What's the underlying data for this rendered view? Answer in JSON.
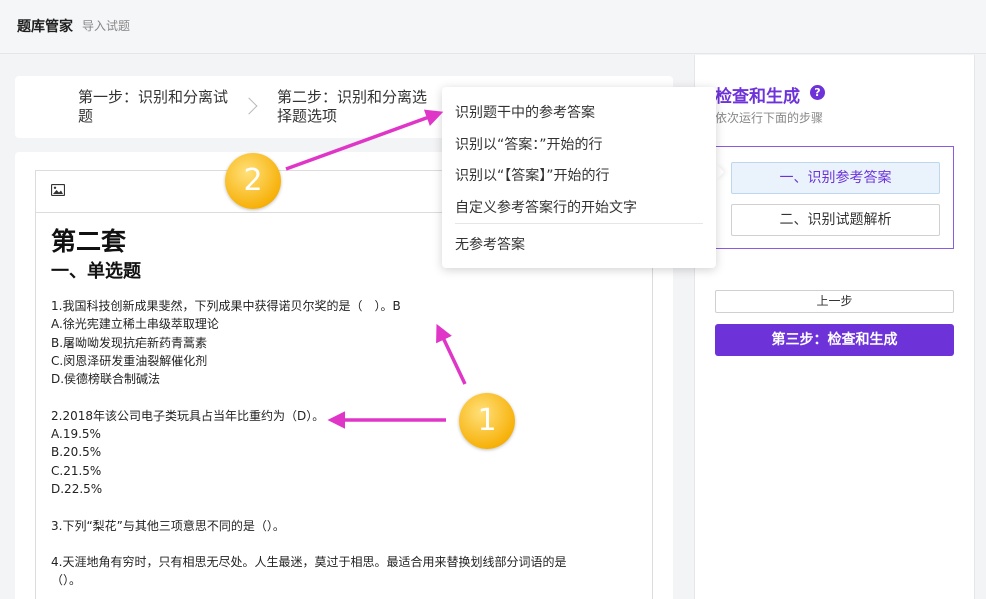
{
  "header": {
    "title": "题库管家",
    "subtitle": "导入试题"
  },
  "steps": [
    {
      "label": "第一步：识别和分离试题"
    },
    {
      "label": "第二步：识别和分离选择题选项"
    }
  ],
  "editor": {
    "heading1": "第二套",
    "heading2": "一、单选题",
    "lines": [
      "1.我国科技创新成果斐然，下列成果中获得诺贝尔奖的是（　）。B",
      "A.徐光宪建立稀土串级萃取理论",
      "B.屠呦呦发现抗疟新药青蒿素",
      "C.闵恩泽研发重油裂解催化剂",
      "D.侯德榜联合制碱法",
      "",
      "2.2018年该公司电子类玩具占当年比重约为（D）。",
      "A.19.5%",
      "B.20.5%",
      "C.21.5%",
      "D.22.5%",
      "",
      "3.下列“梨花”与其他三项意思不同的是（）。",
      "",
      "4.天涯地角有穷时，只有相思无尽处。人生最迷，莫过于相思。最适合用来替换划线部分词语的是",
      "（）。"
    ]
  },
  "dropdown": {
    "items": [
      "识别题干中的参考答案",
      "识别以“答案：”开始的行",
      "识别以“【答案】”开始的行",
      "自定义参考答案行的开始文字",
      "无参考答案"
    ]
  },
  "sidebar": {
    "title": "检查和生成",
    "help": "?",
    "subtitle": "依次运行下面的步骤",
    "options": [
      "一、识别参考答案",
      "二、识别试题解析"
    ],
    "prev_label": "上一步",
    "next_label": "第三步：检查和生成"
  },
  "annotations": {
    "badge1": "1",
    "badge2": "2",
    "arrow_color": "#e036c8"
  },
  "colors": {
    "accent": "#6d33d9",
    "selected_bg": "#eaf3fc"
  }
}
